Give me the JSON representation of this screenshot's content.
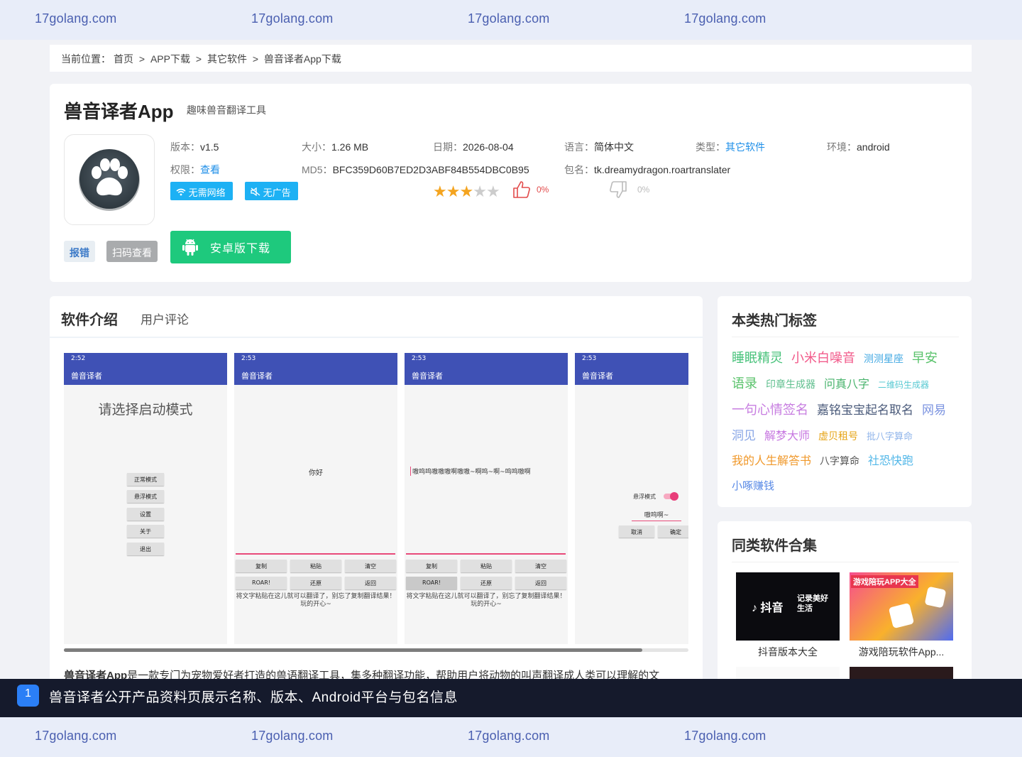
{
  "watermark": {
    "text": "17golang.com"
  },
  "breadcrumb": {
    "label": "当前位置：",
    "home": "首页",
    "sep": ">",
    "c1": "APP下载",
    "c2": "其它软件",
    "c3": "兽音译者App下载"
  },
  "app": {
    "title": "兽音译者App",
    "subtitle": "趣味兽音翻译工具",
    "version_k": "版本：",
    "version_v": "v1.5",
    "size_k": "大小：",
    "size_v": "1.26 MB",
    "date_k": "日期：",
    "date_v": "2026-08-04",
    "lang_k": "语言：",
    "lang_v": "简体中文",
    "type_k": "类型：",
    "type_v": "其它软件",
    "env_k": "环境：",
    "env_v": "android",
    "perm_k": "权限：",
    "perm_v": "查看",
    "md5_k": "MD5：",
    "md5_v": "BFC359D60B7ED2D3ABF84B554DBC0B95",
    "pkg_k": "包名：",
    "pkg_v": "tk.dreamydragon.roartranslater",
    "tag_net": "无需网络",
    "tag_ad": "无广告",
    "rating": 3,
    "rating_max": 5,
    "like_pct": "0%",
    "dislike_pct": "0%",
    "report_btn": "报错",
    "qr_btn": "扫码查看",
    "download_btn": "安卓版下载"
  },
  "tabs": {
    "intro": "软件介绍",
    "comments": "用户评论"
  },
  "screens": {
    "s1": {
      "time": "2:52",
      "title": "兽音译者",
      "heading": "请选择启动模式",
      "b1": "正常模式",
      "b2": "悬浮模式",
      "b3": "设置",
      "b4": "关于",
      "b5": "退出"
    },
    "s2": {
      "time": "2:53",
      "title": "兽音译者",
      "text": "你好",
      "copy": "复制",
      "paste": "粘贴",
      "clear": "清空",
      "roar": "ROAR!",
      "restore": "还原",
      "back": "返回",
      "hint": "将文字粘贴在这儿就可以翻译了，别忘了复制翻译结果！玩的开心~"
    },
    "s3": {
      "time": "2:53",
      "title": "兽音译者",
      "text": "嗷呜呜嗷嗷嗷啊嗷嗷~啊呜~啊~呜呜嗷啊"
    },
    "s4": {
      "time": "2:53",
      "title": "兽音译者",
      "float_label": "悬浮模式",
      "value": "嗷呜啊~",
      "cancel": "取消",
      "ok": "确定"
    }
  },
  "intro": {
    "bold": "兽音译者App",
    "text": "是一款专门为宠物爱好者打造的兽语翻译工具，集多种翻译功能，帮助用户将动物的叫声翻译成人类可以理解的文"
  },
  "sidebar": {
    "hot_title": "本类热门标签",
    "hot_tags": [
      {
        "t": "睡眠精灵",
        "c": "#47c27a",
        "s": 18
      },
      {
        "t": "小米白噪音",
        "c": "#f25a8a",
        "s": 18
      },
      {
        "t": "测测星座",
        "c": "#3fa7e2",
        "s": 14
      },
      {
        "t": "早安",
        "c": "#58c26a",
        "s": 18
      },
      {
        "t": "语录",
        "c": "#58c26a",
        "s": 18
      },
      {
        "t": "印章生成器",
        "c": "#5fbf8e",
        "s": 14
      },
      {
        "t": "问真八字",
        "c": "#49b36c",
        "s": 16
      },
      {
        "t": "二维码生成器",
        "c": "#57c9d2",
        "s": 12
      },
      {
        "t": "一句心情签名",
        "c": "#c77de0",
        "s": 18
      },
      {
        "t": "嘉铭宝宝起名取名",
        "c": "#4a5a7a",
        "s": 17
      },
      {
        "t": "网易",
        "c": "#7b93e0",
        "s": 17
      },
      {
        "t": "洞见",
        "c": "#8aa7e6",
        "s": 17
      },
      {
        "t": "解梦大师",
        "c": "#c778e0",
        "s": 16
      },
      {
        "t": "虚贝租号",
        "c": "#e6a417",
        "s": 14
      },
      {
        "t": "批八字算命",
        "c": "#8fb4ea",
        "s": 13
      },
      {
        "t": "我的人生解答书",
        "c": "#f0982a",
        "s": 16
      },
      {
        "t": "八字算命",
        "c": "#555555",
        "s": 14
      },
      {
        "t": "社恐快跑",
        "c": "#52b7e8",
        "s": 16
      },
      {
        "t": "小啄赚钱",
        "c": "#5b8be6",
        "s": 15
      }
    ],
    "coll_title": "同类软件合集",
    "coll": [
      {
        "label": "抖音版本大全",
        "img_text": "抖音",
        "img_slogan": "记录美好生活"
      },
      {
        "label": "游戏陪玩软件App...",
        "img_text": "游戏陪玩APP大全"
      }
    ]
  },
  "caption": {
    "num": "1",
    "text": "兽音译者公开产品资料页展示名称、版本、Android平台与包名信息"
  }
}
